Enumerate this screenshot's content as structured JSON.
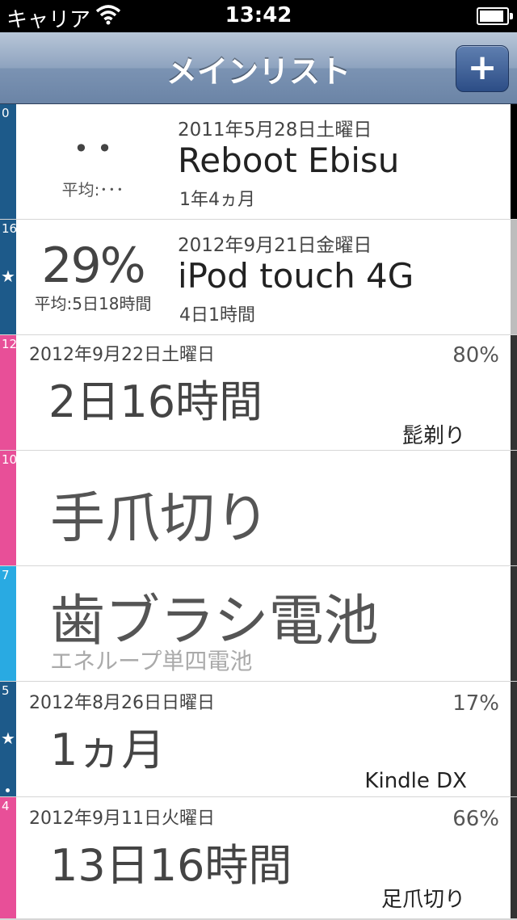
{
  "status_bar": {
    "carrier": "キャリア",
    "time": "13:42",
    "wifi_icon": "wifi-icon",
    "battery_icon": "battery-icon",
    "battery_level": 0.9
  },
  "nav": {
    "title": "メインリスト",
    "add_label": "+"
  },
  "colors": {
    "blue": "#1d5a8a",
    "pink": "#e84f98",
    "light_blue": "#29aae2",
    "nav_blue": "#7b93b3"
  },
  "rows": [
    {
      "count": "0",
      "progress_face": "• •",
      "average": "平均:･･･",
      "date": "2011年5月28日土曜日",
      "name": "Reboot Ebisu",
      "elapsed": "1年4ヵ月"
    },
    {
      "count": "16",
      "star": "★",
      "percent": "29%",
      "average": "平均:5日18時間",
      "date": "2012年9月21日金曜日",
      "name": "iPod touch 4G",
      "elapsed": "4日1時間"
    },
    {
      "count": "12",
      "date": "2012年9月22日土曜日",
      "elapsed": "2日16時間",
      "percent": "80%",
      "name": "髭剃り"
    },
    {
      "count": "10",
      "name": "手爪切り"
    },
    {
      "count": "7",
      "name": "歯ブラシ電池",
      "subtitle": "エネループ単四電池"
    },
    {
      "count": "5",
      "star": "★",
      "date": "2012年8月26日日曜日",
      "elapsed": "1ヵ月",
      "percent": "17%",
      "name": "Kindle DX"
    },
    {
      "count": "4",
      "date": "2012年9月11日火曜日",
      "elapsed": "13日16時間",
      "percent": "66%",
      "name": "足爪切り"
    }
  ]
}
